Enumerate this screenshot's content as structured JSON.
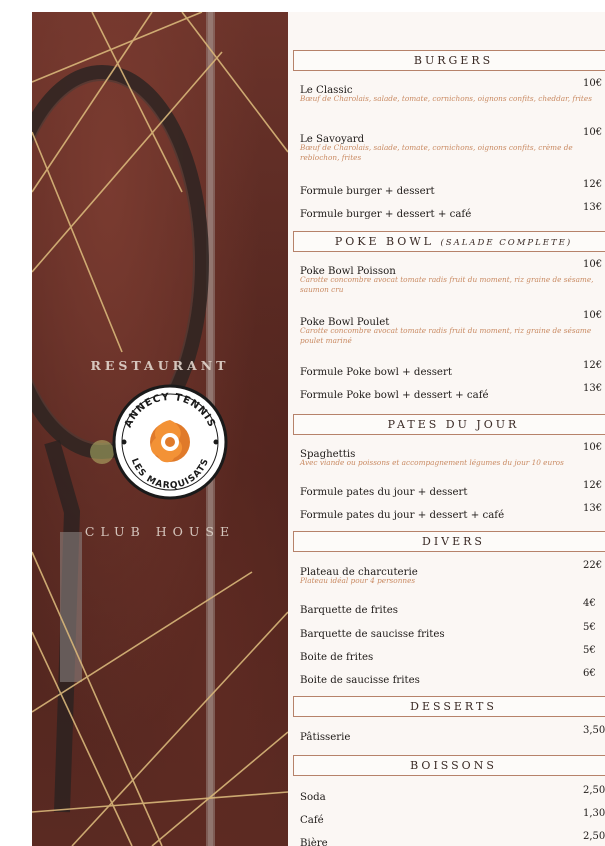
{
  "brand": {
    "top_word": "RESTAURANT",
    "bottom_word": "CLUB HOUSE",
    "logo_ring_top": "ANNECY TENNIS",
    "logo_ring_bottom": "LES MARQUISATS"
  },
  "colors": {
    "accent": "#b6826a",
    "description": "#c98a62",
    "panel": "#5e2a22",
    "logo_orange": "#e07a2a"
  },
  "sections": [
    {
      "title": "BURGERS",
      "subtitle": "",
      "items": [
        {
          "name": "Le Classic",
          "price": "10€",
          "desc": "Bœuf de Charolais, salade, tomate, cornichons, oignons confits, cheddar, frites"
        },
        {
          "name": "Le Savoyard",
          "price": "10€",
          "desc": "Bœuf de Charolais, salade, tomate, cornichons, oignons confits, crème de reblochon, frites"
        },
        {
          "name": "Formule burger + dessert",
          "price": "12€",
          "desc": ""
        },
        {
          "name": "Formule burger + dessert + café",
          "price": "13€",
          "desc": ""
        }
      ]
    },
    {
      "title": "POKE BOWL",
      "subtitle": "(SALADE COMPLETE)",
      "items": [
        {
          "name": "Poke Bowl Poisson",
          "price": "10€",
          "desc": "Carotte concombre avocat tomate radis fruit du moment, riz graine de sésame, saumon cru"
        },
        {
          "name": "Poke Bowl Poulet",
          "price": "10€",
          "desc": "Carotte concombre avocat tomate radis fruit du moment, riz graine de sésame poulet mariné"
        },
        {
          "name": "Formule Poke bowl + dessert",
          "price": "12€",
          "desc": ""
        },
        {
          "name": "Formule Poke bowl + dessert + café",
          "price": "13€",
          "desc": ""
        }
      ]
    },
    {
      "title": "PATES DU JOUR",
      "subtitle": "",
      "items": [
        {
          "name": "Spaghettis",
          "price": "10€",
          "desc": "Avec viande ou poissons et accompagnement légumes du jour 10 euros"
        },
        {
          "name": "Formule pates du jour + dessert",
          "price": "12€",
          "desc": ""
        },
        {
          "name": "Formule pates du jour + dessert + café",
          "price": "13€",
          "desc": ""
        }
      ]
    },
    {
      "title": "DIVERS",
      "subtitle": "",
      "items": [
        {
          "name": "Plateau de charcuterie",
          "price": "22€",
          "desc": "Plateau idéal pour 4 personnes"
        },
        {
          "name": "Barquette de frites",
          "price": "4€",
          "desc": ""
        },
        {
          "name": "Barquette de saucisse frites",
          "price": "5€",
          "desc": ""
        },
        {
          "name": "Boite de frites",
          "price": "5€",
          "desc": ""
        },
        {
          "name": "Boite de saucisse frites",
          "price": "6€",
          "desc": ""
        }
      ]
    },
    {
      "title": "DESSERTS",
      "subtitle": "",
      "items": [
        {
          "name": "Pâtisserie",
          "price": "3,50€",
          "desc": ""
        }
      ]
    },
    {
      "title": "BOISSONS",
      "subtitle": "",
      "items": [
        {
          "name": "Soda",
          "price": "2,50€",
          "desc": ""
        },
        {
          "name": "Café",
          "price": "1,30€",
          "desc": ""
        },
        {
          "name": "Bière",
          "price": "2,50€",
          "desc": ""
        }
      ]
    }
  ]
}
